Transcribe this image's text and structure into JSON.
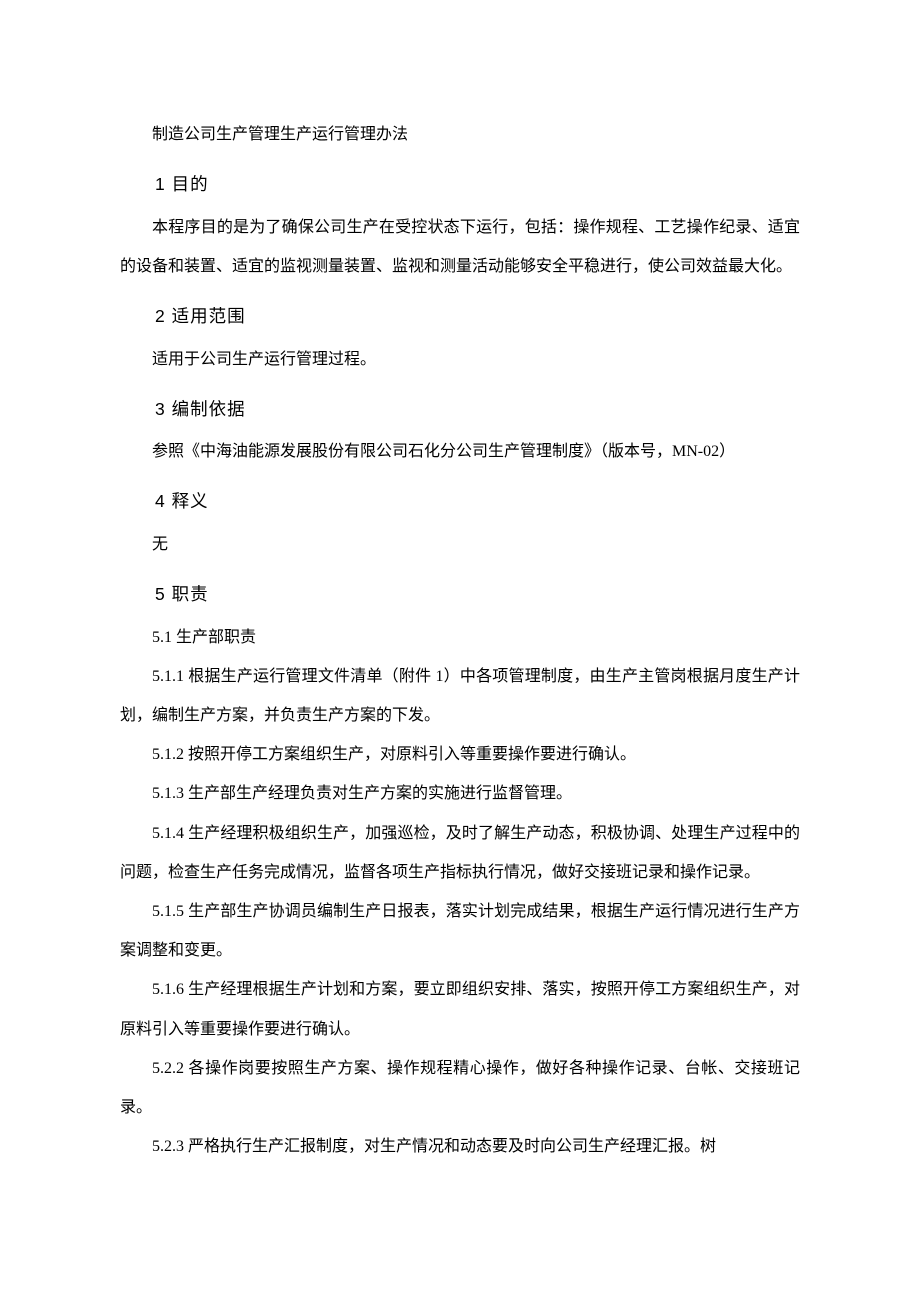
{
  "title": "制造公司生产管理生产运行管理办法",
  "s1": {
    "heading": "1 目的",
    "body": "本程序目的是为了确保公司生产在受控状态下运行，包括：操作规程、工艺操作纪录、适宜的设备和装置、适宜的监视测量装置、监视和测量活动能够安全平稳进行，使公司效益最大化。"
  },
  "s2": {
    "heading": "2 适用范围",
    "body": "适用于公司生产运行管理过程。"
  },
  "s3": {
    "heading": "3 编制依据",
    "body": "参照《中海油能源发展股份有限公司石化分公司生产管理制度》（版本号，MN-02）"
  },
  "s4": {
    "heading": "4 释义",
    "body": "无"
  },
  "s5": {
    "heading": "5 职责",
    "p5_1": "5.1 生产部职责",
    "p5_1_1": "5.1.1 根据生产运行管理文件清单（附件 1）中各项管理制度，由生产主管岗根据月度生产计划，编制生产方案，并负责生产方案的下发。",
    "p5_1_2": "5.1.2 按照开停工方案组织生产，对原料引入等重要操作要进行确认。",
    "p5_1_3": "5.1.3 生产部生产经理负责对生产方案的实施进行监督管理。",
    "p5_1_4": "5.1.4 生产经理积极组织生产，加强巡检，及时了解生产动态，积极协调、处理生产过程中的问题，检查生产任务完成情况，监督各项生产指标执行情况，做好交接班记录和操作记录。",
    "p5_1_5": "5.1.5 生产部生产协调员编制生产日报表，落实计划完成结果，根据生产运行情况进行生产方案调整和变更。",
    "p5_1_6": "5.1.6 生产经理根据生产计划和方案，要立即组织安排、落实，按照开停工方案组织生产，对原料引入等重要操作要进行确认。",
    "p5_2_2": "5.2.2 各操作岗要按照生产方案、操作规程精心操作，做好各种操作记录、台帐、交接班记录。",
    "p5_2_3": "5.2.3 严格执行生产汇报制度，对生产情况和动态要及时向公司生产经理汇报。树"
  }
}
